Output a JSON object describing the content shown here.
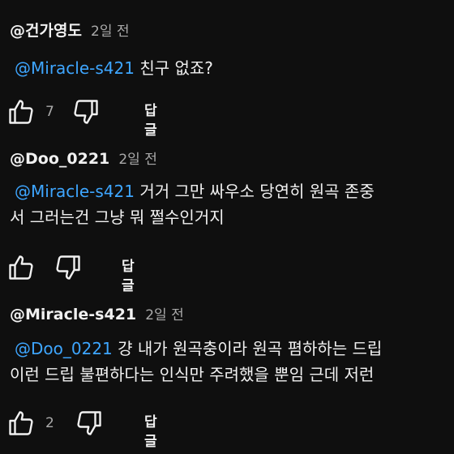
{
  "comments": [
    {
      "author": "@건가영도",
      "time": "2일 전",
      "mention": "@Miracle-s421",
      "lines": [
        "친구 없죠?"
      ],
      "likes": "7",
      "reply_label": "답글"
    },
    {
      "author": "@Doo_0221",
      "time": "2일 전",
      "mention": "@Miracle-s421",
      "lines": [
        "거거 그만 싸우소 당연히 원곡 존중",
        "서 그러는건 그냥 뭐 쩔수인거지"
      ],
      "likes": "",
      "reply_label": "답글"
    },
    {
      "author": "@Miracle-s421",
      "time": "2일 전",
      "mention": "@Doo_0221",
      "lines": [
        "걍 내가 원곡충이라 원곡 폄하하는 드립",
        "이런 드립 불편하다는 인식만 주려했을 뿐임 근데 저런"
      ],
      "likes": "2",
      "reply_label": "답글"
    }
  ],
  "colors": {
    "background": "#0f0f0f",
    "text": "#f1f1f1",
    "secondary": "#aaaaaa",
    "mention": "#3ea6ff"
  },
  "icons": [
    "like-icon",
    "dislike-icon"
  ]
}
